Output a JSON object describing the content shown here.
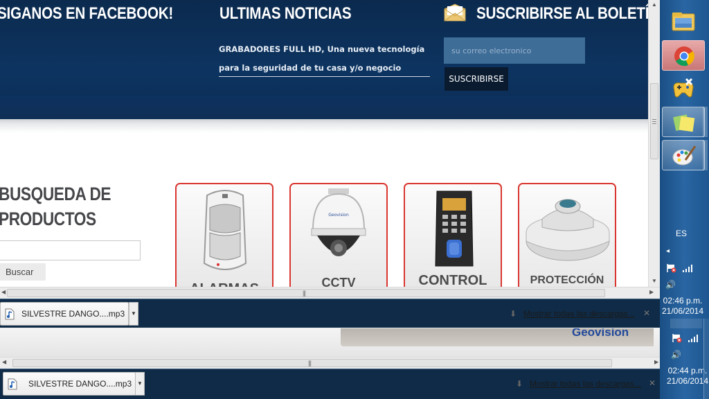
{
  "page": {
    "facebook_title": "SIGANOS EN FACEBOOK!",
    "news_title": "ULTIMAS NOTICIAS",
    "subscribe_title": "SUSCRIBIRSE AL BOLETÍN",
    "news_line1": "GRABADORES FULL HD, Una nueva tecnología",
    "news_line2": "para la seguridad de tu casa y/o negocio",
    "email_placeholder": "su correo electronico",
    "subscribe_button": "SUSCRIBIRSE",
    "search_title_line1": "BUSQUEDA DE",
    "search_title_line2": "PRODUCTOS",
    "search_button": "Buscar",
    "products": [
      {
        "label": "ALARMAS"
      },
      {
        "label": "CCTV"
      },
      {
        "label": "CONTROL"
      },
      {
        "label": "PROTECCIÓN"
      }
    ]
  },
  "downloads": [
    {
      "file": "SILVESTRE DANGO....mp3",
      "show_all": "Mostrar todas las descargas..."
    },
    {
      "file": "SILVESTRE DANGO....mp3",
      "show_all": "Mostrar todas las descargas..."
    }
  ],
  "lower_page": {
    "brand": "Geovision"
  },
  "taskbar": {
    "language": "ES",
    "clock1_time": "02:46 p.m.",
    "clock1_date": "21/06/2014",
    "clock2_time": "02:44 p.m.",
    "clock2_date": "21/06/2014",
    "apps": [
      "file-explorer-icon",
      "chrome-icon",
      "game-controller-icon",
      "sticky-notes-icon",
      "paint-icon"
    ]
  },
  "colors": {
    "header_blue": "#0d3461",
    "card_border": "#d9362f",
    "taskbar_blue": "#2a66a3"
  }
}
